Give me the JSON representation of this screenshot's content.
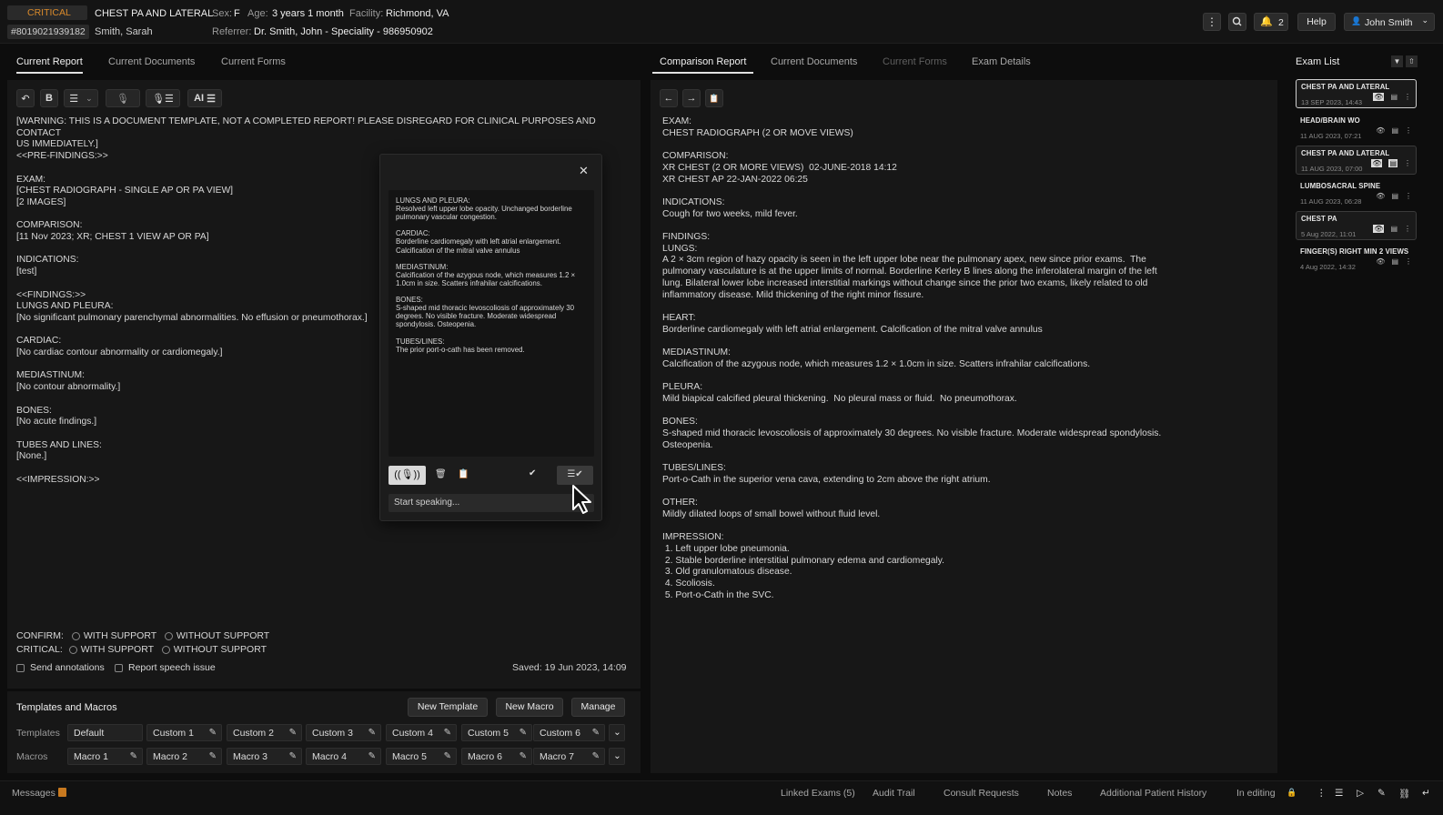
{
  "header": {
    "critical_badge": "CRITICAL",
    "exam_title": "CHEST PA AND LATERAL",
    "sex_label": "Sex:",
    "sex_value": "F",
    "age_label": "Age:",
    "age_value": "3 years 1 month",
    "facility_label": "Facility:",
    "facility_value": "Richmond, VA",
    "accession": "#8019021939182",
    "patient_name": "Smith, Sarah",
    "referrer_label": "Referrer:",
    "referrer_value": "Dr. Smith, John - Speciality - 986950902",
    "notification_count": "2",
    "help_label": "Help",
    "user_name": "John Smith"
  },
  "left_tabs": [
    "Current Report",
    "Current Documents",
    "Current Forms"
  ],
  "right_tabs": [
    "Comparison Report",
    "Current Documents",
    "Current Forms",
    "Exam Details"
  ],
  "editor_toolbar": {
    "bold": "B",
    "ai": "AI"
  },
  "current_report": "[WARNING: THIS IS A DOCUMENT TEMPLATE, NOT A COMPLETED REPORT! PLEASE DISREGARD FOR CLINICAL PURPOSES AND CONTACT\nUS IMMEDIATELY.]\n<<PRE-FINDINGS:>>\n\nEXAM:\n[CHEST RADIOGRAPH - SINGLE AP OR PA VIEW]\n[2 IMAGES]\n\nCOMPARISON:\n[11 Nov 2023; XR; CHEST 1 VIEW AP OR PA]\n\nINDICATIONS:\n[test]\n\n<<FINDINGS:>>\nLUNGS AND PLEURA:\n[No significant pulmonary parenchymal abnormalities. No effusion or pneumothorax.]\n\nCARDIAC:\n[No cardiac contour abnormality or cardiomegaly.]\n\nMEDIASTINUM:\n[No contour abnormality.]\n\nBONES:\n[No acute findings.]\n\nTUBES AND LINES:\n[None.]\n\n<<IMPRESSION:>>",
  "confirm": {
    "label": "CONFIRM:",
    "opt1": "WITH SUPPORT",
    "opt2": "WITHOUT SUPPORT"
  },
  "critical": {
    "label": "CRITICAL:",
    "opt1": "WITH SUPPORT",
    "opt2": "WITHOUT SUPPORT"
  },
  "send_annotations": "Send annotations",
  "report_speech_issue": "Report speech issue",
  "saved": "Saved: 19 Jun 2023, 14:09",
  "dictation_popup": {
    "text": "LUNGS AND PLEURA:\nResolved left upper lobe opacity. Unchanged borderline pulmonary vascular congestion.\n\nCARDIAC:\nBorderline cardiomegaly with left atrial enlargement. Calcification of the mitral valve annulus\n\nMEDIASTINUM:\nCalcification of the azygous node, which measures 1.2 × 1.0cm in size. Scatters infrahilar calcifications.\n\nBONES:\nS-shaped mid thoracic levoscoliosis of approximately 30 degrees. No visible fracture. Moderate widespread spondylosis. Osteopenia.\n\nTUBES/LINES:\nThe prior port-o-cath has been removed.",
    "placeholder": "Start speaking..."
  },
  "templates_macros": {
    "title": "Templates and Macros",
    "new_template": "New Template",
    "new_macro": "New Macro",
    "manage": "Manage",
    "templates_label": "Templates",
    "macros_label": "Macros",
    "templates": [
      "Default",
      "Custom 1",
      "Custom 2",
      "Custom 3",
      "Custom 4",
      "Custom 5",
      "Custom 6"
    ],
    "macros": [
      "Macro 1",
      "Macro 2",
      "Macro 3",
      "Macro 4",
      "Macro 5",
      "Macro 6",
      "Macro 7"
    ]
  },
  "comparison_report": "EXAM:\nCHEST RADIOGRAPH (2 OR MOVE VIEWS)\n\nCOMPARISON:\nXR CHEST (2 OR MORE VIEWS)  02-JUNE-2018 14:12\nXR CHEST AP 22-JAN-2022 06:25\n\nINDICATIONS:\nCough for two weeks, mild fever.\n\nFINDINGS:\nLUNGS:\nA 2 × 3cm region of hazy opacity is seen in the left upper lobe near the pulmonary apex, new since prior exams.  The\npulmonary vasculature is at the upper limits of normal. Borderline Kerley B lines along the inferolateral margin of the left\nlung. Bilateral lower lobe increased interstitial markings without change since the prior two exams, likely related to old\ninflammatory disease. Mild thickening of the right minor fissure.\n\nHEART:\nBorderline cardiomegaly with left atrial enlargement. Calcification of the mitral valve annulus\n\nMEDIASTINUM:\nCalcification of the azygous node, which measures 1.2 × 1.0cm in size. Scatters infrahilar calcifications.\n\nPLEURA:\nMild biapical calcified pleural thickening.  No pleural mass or fluid.  No pneumothorax.\n\nBONES:\nS-shaped mid thoracic levoscoliosis of approximately 30 degrees. No visible fracture. Moderate widespread spondylosis.\nOsteopenia.\n\nTUBES/LINES:\nPort-o-Cath in the superior vena cava, extending to 2cm above the right atrium.\n\nOTHER:\nMildly dilated loops of small bowel without fluid level.\n\nIMPRESSION:\n 1. Left upper lobe pneumonia.\n 2. Stable borderline interstitial pulmonary edema and cardiomegaly.\n 3. Old granulomatous disease.\n 4. Scoliosis.\n 5. Port-o-Cath in the SVC.",
  "exam_list": {
    "title": "Exam List",
    "items": [
      {
        "title": "CHEST PA AND LATERAL",
        "date": "13 SEP 2023, 14:43"
      },
      {
        "title": "HEAD/BRAIN WO",
        "date": "11 AUG 2023, 07:21"
      },
      {
        "title": "CHEST PA AND LATERAL",
        "date": "11 AUG 2023, 07:00"
      },
      {
        "title": "LUMBOSACRAL SPINE",
        "date": "11 AUG 2023, 06:28"
      },
      {
        "title": "CHEST PA",
        "date": "5 Aug 2022, 11:01"
      },
      {
        "title": "FINGER(S) RIGHT MIN 2 VIEWS",
        "date": "4 Aug 2022, 14:32"
      }
    ]
  },
  "footer": {
    "messages": "Messages",
    "linked_exams": "Linked Exams (5)",
    "audit_trail": "Audit Trail",
    "consult_requests": "Consult Requests",
    "notes": "Notes",
    "additional_history": "Additional Patient History",
    "in_editing": "In editing"
  },
  "colors": {
    "critical": "#c8791f",
    "background": "#0d0d0d",
    "panel": "#171717"
  }
}
